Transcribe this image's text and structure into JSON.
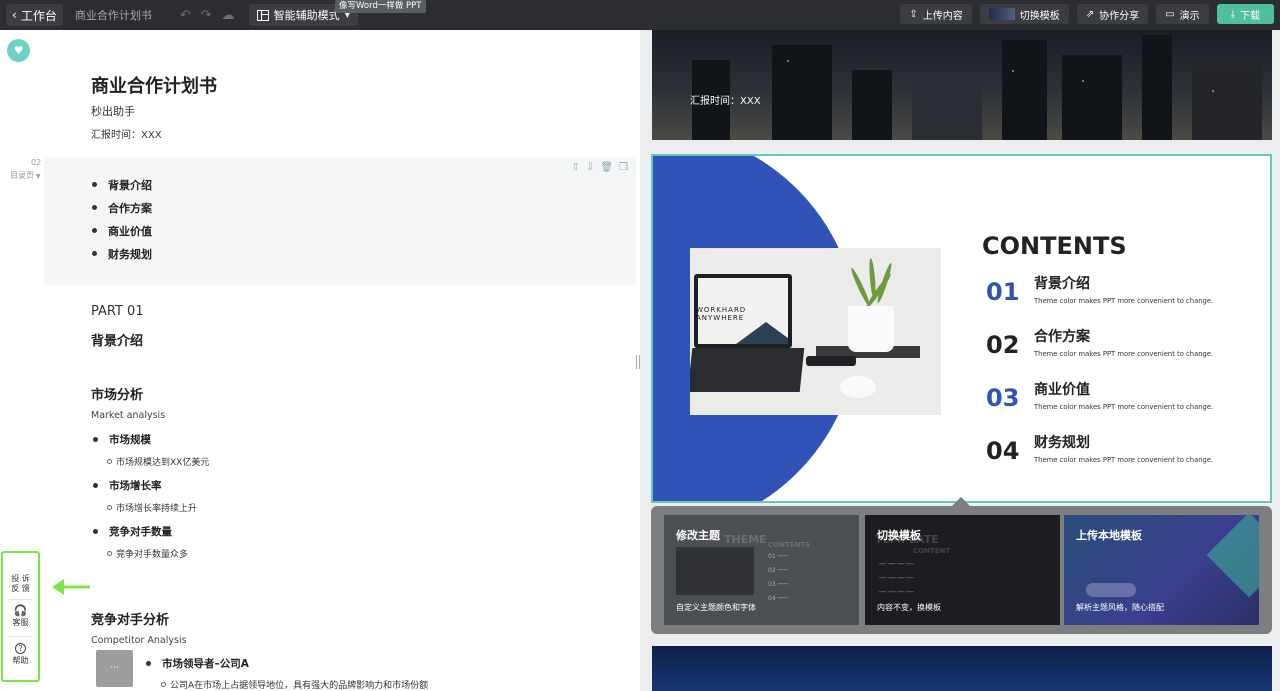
{
  "topbar": {
    "back_label": "工作台",
    "doc_name": "商业合作计划书",
    "mode_label": "智能辅助模式",
    "mode_tooltip": "像写Word一样做 PPT",
    "upload_label": "上传内容",
    "switch_template_label": "切换模板",
    "share_label": "协作分享",
    "present_label": "演示",
    "download_label": "下载"
  },
  "editor": {
    "title": "商业合作计划书",
    "subtitle": "秒出助手",
    "date": "汇报时间：XXX",
    "page_number": "02",
    "page_type": "目录页",
    "toc": [
      "背景介绍",
      "合作方案",
      "商业价值",
      "财务规划"
    ],
    "part_number": "PART 01",
    "part_title": "背景介绍",
    "market": {
      "title": "市场分析",
      "subtitle": "Market analysis",
      "items": [
        {
          "label": "市场规模",
          "detail": "市场规模达到XX亿美元"
        },
        {
          "label": "市场增长率",
          "detail": "市场增长率持续上升"
        },
        {
          "label": "竞争对手数量",
          "detail": "竞争对手数量众多"
        }
      ]
    },
    "competitor": {
      "title": "竞争对手分析",
      "subtitle": "Competitor Analysis",
      "leader": "市场领导者–公司A",
      "leader_detail": "公司A在市场上占据领导地位，具有强大的品牌影响力和市场份额",
      "icon_text": "···"
    }
  },
  "side_tools": {
    "feedback": "投 诉\n反 馈",
    "service": "客服",
    "help": "帮助"
  },
  "preview": {
    "slide1_date": "汇报时间：XXX",
    "slide2": {
      "contents_title": "CONTENTS",
      "laptop_text": "WORKHARD\nANYWHERE",
      "items": [
        {
          "num": "01",
          "title": "背景介绍",
          "desc": "Theme color makes PPT more convenient to change."
        },
        {
          "num": "02",
          "title": "合作方案",
          "desc": "Theme color makes PPT more convenient to change."
        },
        {
          "num": "03",
          "title": "商业价值",
          "desc": "Theme color makes PPT more convenient to change."
        },
        {
          "num": "04",
          "title": "财务规划",
          "desc": "Theme color makes PPT more convenient to change."
        }
      ]
    },
    "popup": {
      "cards": [
        {
          "title": "修改主题",
          "desc": "自定义主题颜色和字体"
        },
        {
          "title": "切换模板",
          "desc": "内容不变，换模板"
        },
        {
          "title": "上传本地模板",
          "desc": "解析主题风格，随心搭配"
        }
      ]
    }
  },
  "colors": {
    "accent": "#4fbf9f",
    "slide_blue": "#3153b7",
    "highlight_green": "#7fe34e"
  }
}
